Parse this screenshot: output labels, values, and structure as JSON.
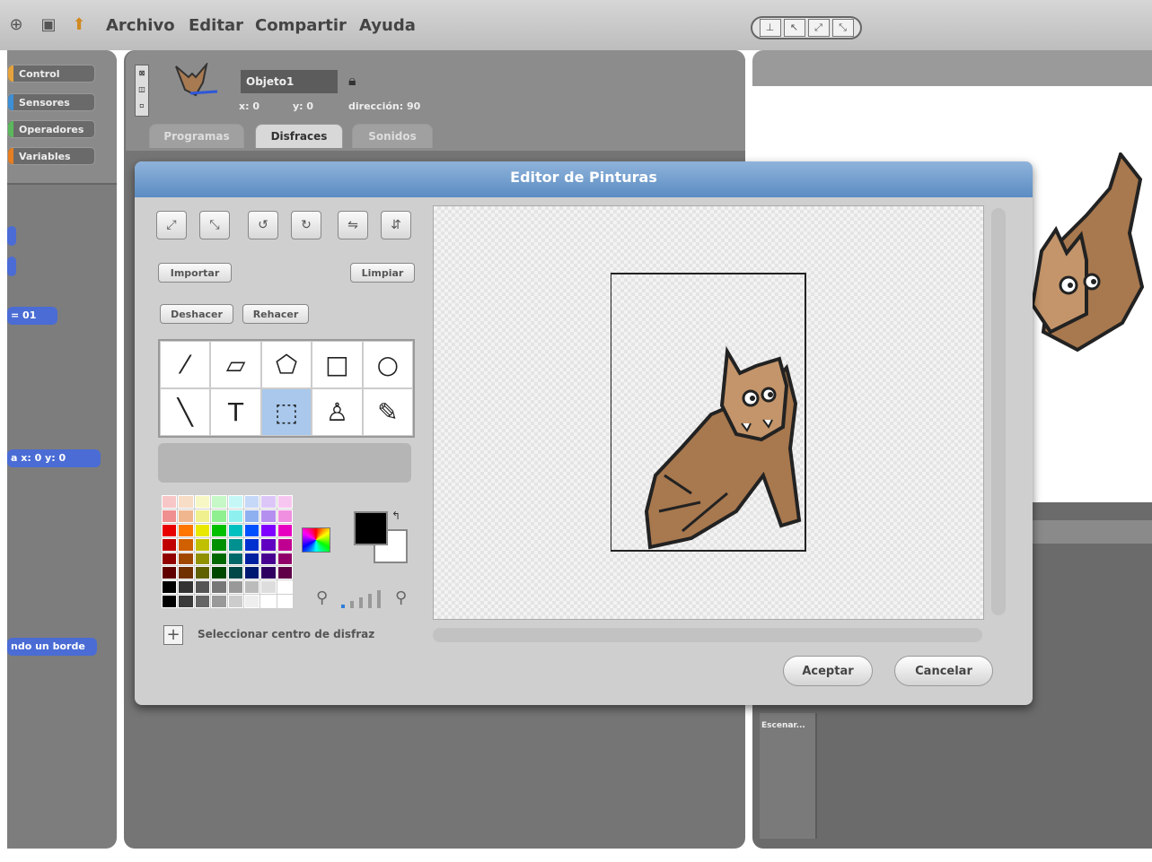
{
  "menu": {
    "items": [
      "Archivo",
      "Editar",
      "Compartir",
      "Ayuda"
    ]
  },
  "categories": [
    {
      "label": "Control",
      "color": "#e6a23c"
    },
    {
      "label": "Sensores",
      "color": "#3d8fd6"
    },
    {
      "label": "Operadores",
      "color": "#5cb85c"
    },
    {
      "label": "Variables",
      "color": "#e67e22"
    }
  ],
  "palette_blocks": {
    "b1": "",
    "b2": "",
    "b3": "= 01",
    "b4": "a x: 0 y: 0",
    "b5": "ndo un borde"
  },
  "sprite": {
    "name": "Objeto1",
    "x_label": "x: 0",
    "y_label": "y: 0",
    "direction_label": "dirección: 90"
  },
  "tabs": [
    "Programas",
    "Disfraces",
    "Sonidos"
  ],
  "stage_thumb_label": "Escenar...",
  "dialog": {
    "title": "Editor de Pinturas",
    "import_label": "Importar",
    "clear_label": "Limpiar",
    "undo_label": "Deshacer",
    "redo_label": "Rehacer",
    "set_center_label": "Seleccionar centro de disfraz",
    "ok_label": "Aceptar",
    "cancel_label": "Cancelar",
    "foreground_color": "#000000",
    "background_color": "#ffffff"
  },
  "tools": [
    {
      "name": "paintbrush-icon",
      "glyph": "⁄"
    },
    {
      "name": "eraser-icon",
      "glyph": "▱"
    },
    {
      "name": "fill-bucket-icon",
      "glyph": "⬠"
    },
    {
      "name": "rectangle-icon",
      "glyph": "□"
    },
    {
      "name": "ellipse-icon",
      "glyph": "○"
    },
    {
      "name": "line-icon",
      "glyph": "╲"
    },
    {
      "name": "text-icon",
      "glyph": "T"
    },
    {
      "name": "select-icon",
      "glyph": "⬚"
    },
    {
      "name": "stamp-icon",
      "glyph": "♙"
    },
    {
      "name": "eyedropper-icon",
      "glyph": "✎"
    }
  ],
  "colors": [
    "#f7c6c6",
    "#f7dcc6",
    "#f7f7c6",
    "#c6f7c6",
    "#c6f7f7",
    "#c6d8f7",
    "#dcc6f7",
    "#f7c6f0",
    "#f08f8f",
    "#f0b78f",
    "#f0f08f",
    "#8ff08f",
    "#8ff0f0",
    "#8fb0f0",
    "#b58ff0",
    "#f08fe0",
    "#e80000",
    "#ff7700",
    "#e8e800",
    "#00c000",
    "#00c0c0",
    "#0050ff",
    "#8000ff",
    "#e800c0",
    "#c00000",
    "#d06000",
    "#c0c000",
    "#009000",
    "#009090",
    "#0030d0",
    "#6000c0",
    "#c00090",
    "#900000",
    "#a04800",
    "#909000",
    "#006800",
    "#006868",
    "#0020a0",
    "#480090",
    "#900068",
    "#600000",
    "#703000",
    "#606000",
    "#004800",
    "#004848",
    "#001870",
    "#300060",
    "#600048",
    "#000000",
    "#333333",
    "#555555",
    "#777777",
    "#999999",
    "#bbbbbb",
    "#dddddd",
    "#ffffff",
    "#000000",
    "#3a3a3a",
    "#666666",
    "#999999",
    "#cccccc",
    "#eeeeee",
    "#ffffff",
    "#ffffff"
  ]
}
